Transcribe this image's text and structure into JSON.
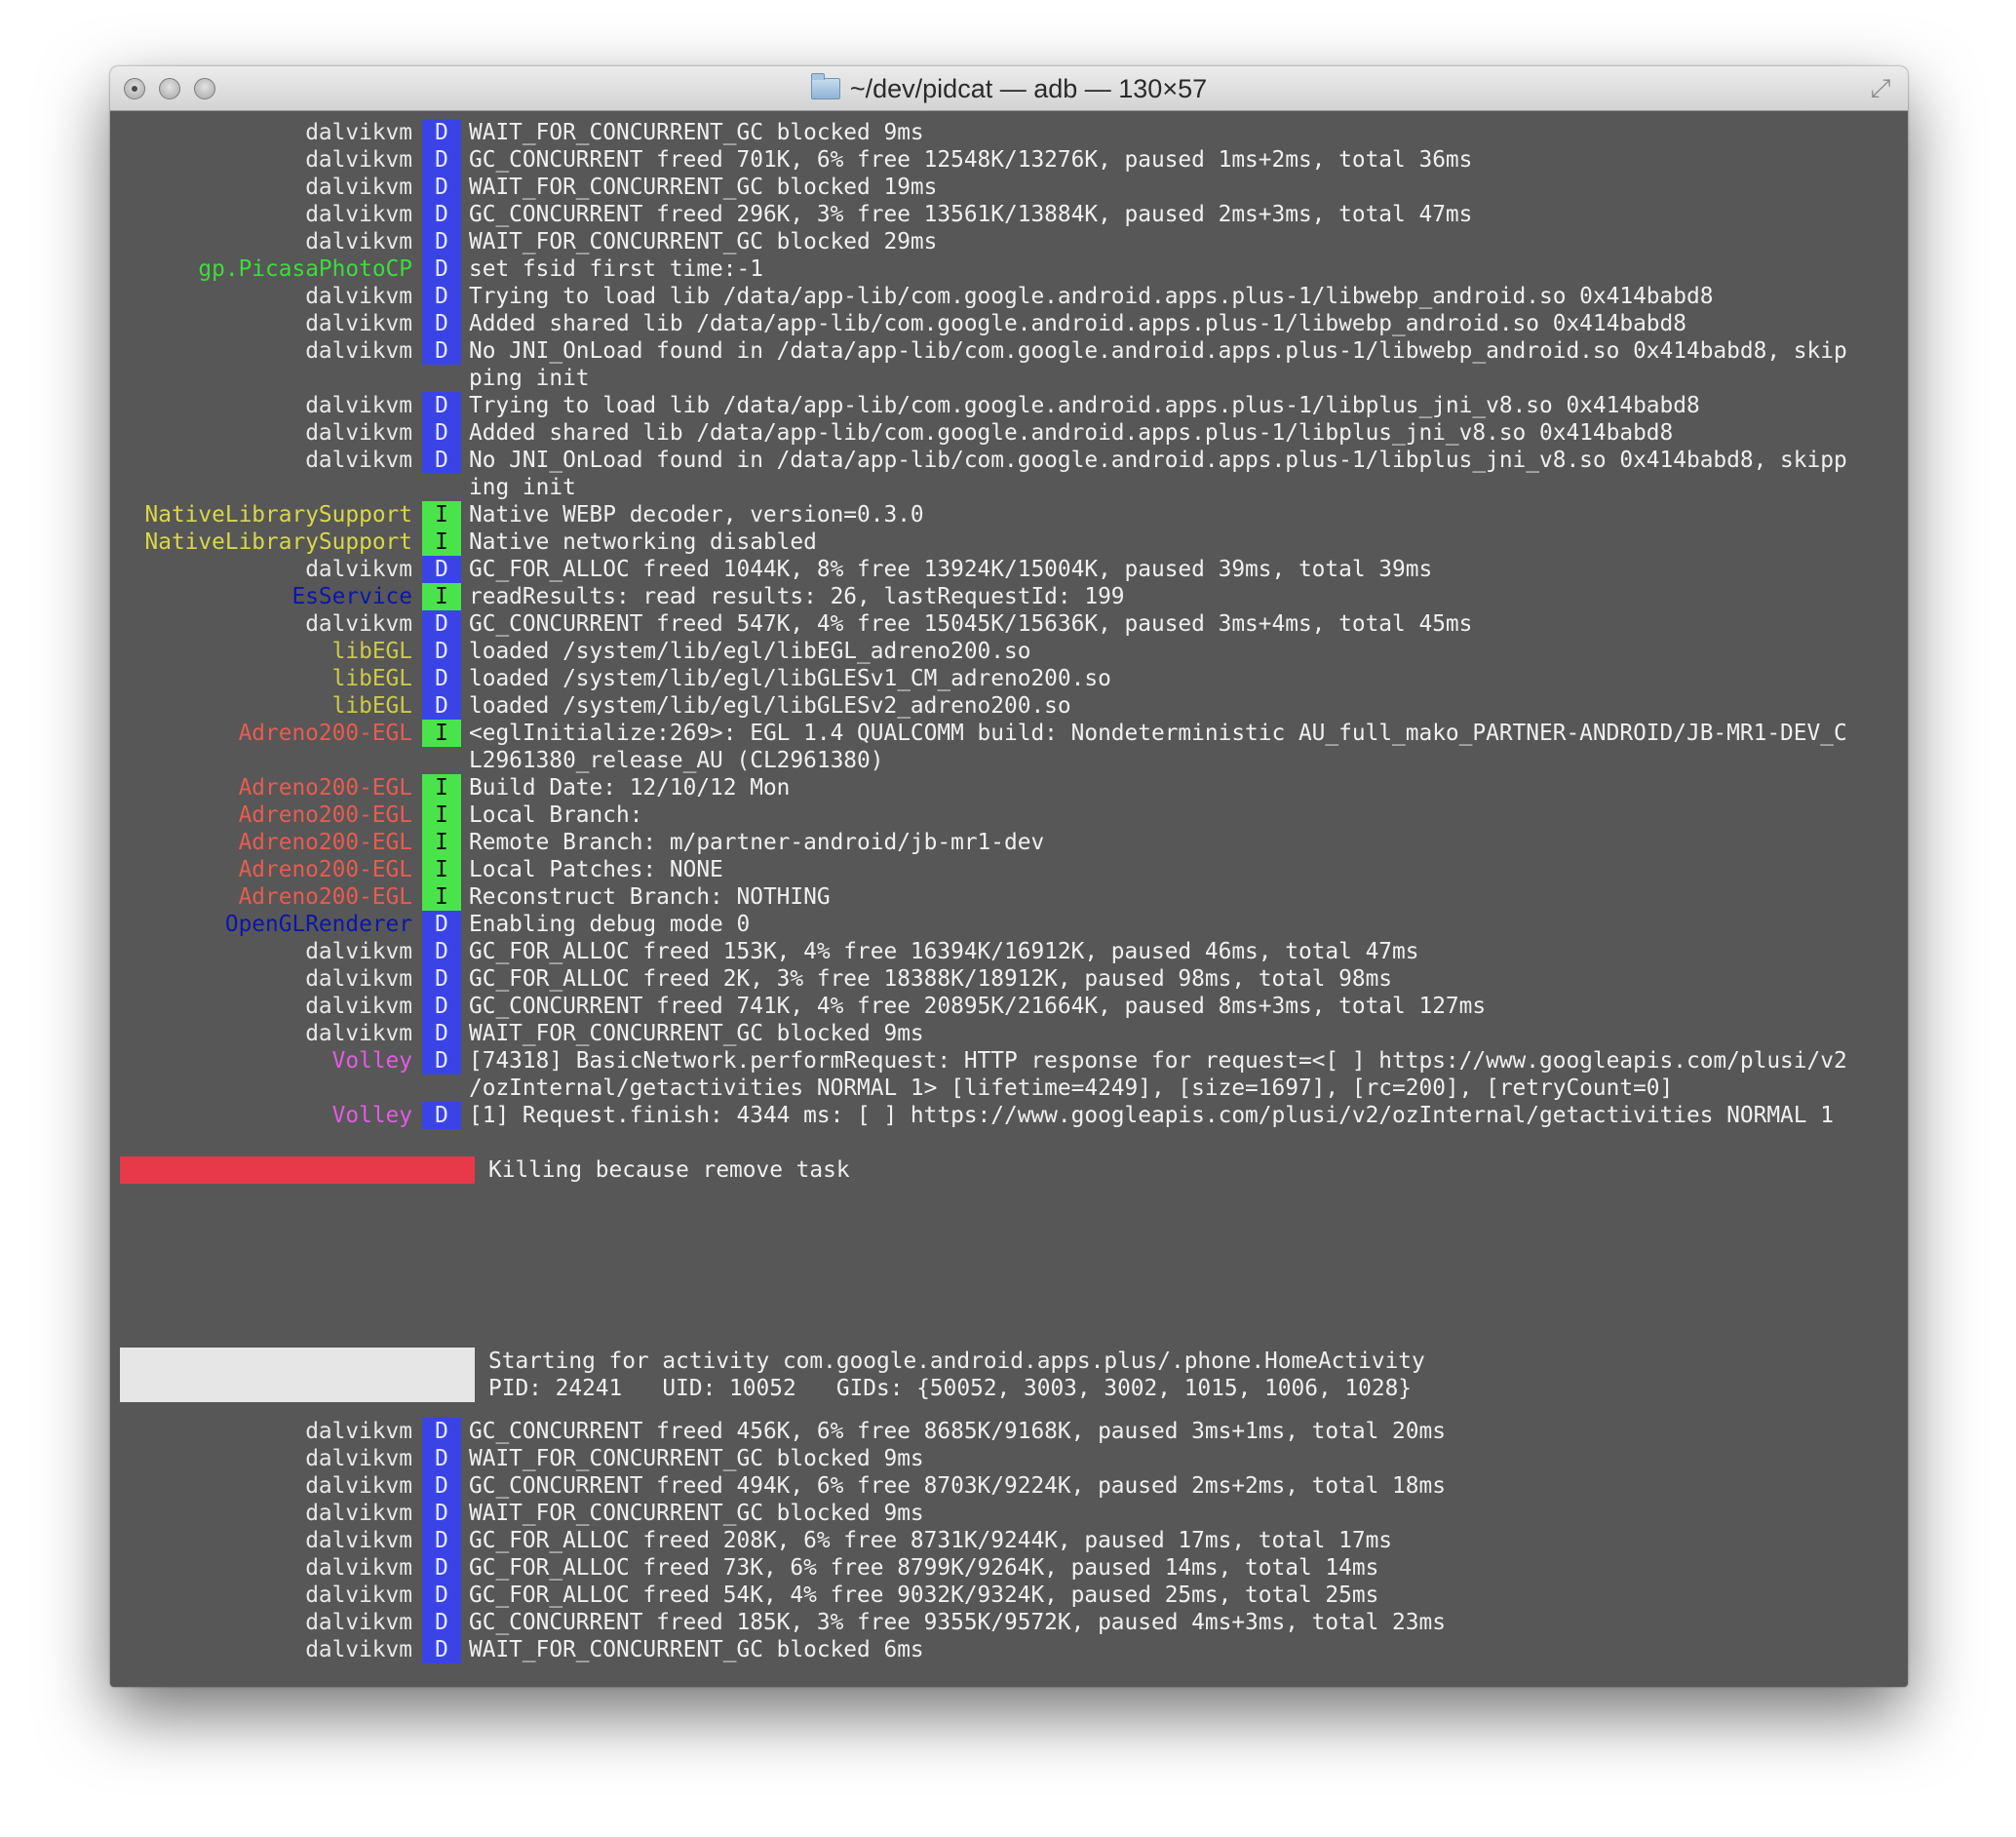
{
  "window": {
    "title": "~/dev/pidcat — adb — 130×57"
  },
  "colors": {
    "dalvikvm": "#e8e8e8",
    "gp.PicasaPhotoCP": "#3ddc3d",
    "NativeLibrarySupport": "#d8d84a",
    "EsService": "#0d16a8",
    "libEGL": "#cbcb46",
    "Adreno200-EGL": "#e85c50",
    "OpenGLRenderer": "#0d16a8",
    "Volley": "#e35ae3"
  },
  "lines_top": [
    {
      "tag": "dalvikvm",
      "lvl": "D",
      "msg": "WAIT_FOR_CONCURRENT_GC blocked 9ms"
    },
    {
      "tag": "dalvikvm",
      "lvl": "D",
      "msg": "GC_CONCURRENT freed 701K, 6% free 12548K/13276K, paused 1ms+2ms, total 36ms"
    },
    {
      "tag": "dalvikvm",
      "lvl": "D",
      "msg": "WAIT_FOR_CONCURRENT_GC blocked 19ms"
    },
    {
      "tag": "dalvikvm",
      "lvl": "D",
      "msg": "GC_CONCURRENT freed 296K, 3% free 13561K/13884K, paused 2ms+3ms, total 47ms"
    },
    {
      "tag": "dalvikvm",
      "lvl": "D",
      "msg": "WAIT_FOR_CONCURRENT_GC blocked 29ms"
    },
    {
      "tag": "gp.PicasaPhotoCP",
      "lvl": "D",
      "msg": "set fsid first time:-1"
    },
    {
      "tag": "dalvikvm",
      "lvl": "D",
      "msg": "Trying to load lib /data/app-lib/com.google.android.apps.plus-1/libwebp_android.so 0x414babd8"
    },
    {
      "tag": "dalvikvm",
      "lvl": "D",
      "msg": "Added shared lib /data/app-lib/com.google.android.apps.plus-1/libwebp_android.so 0x414babd8"
    },
    {
      "tag": "dalvikvm",
      "lvl": "D",
      "msg": "No JNI_OnLoad found in /data/app-lib/com.google.android.apps.plus-1/libwebp_android.so 0x414babd8, skip"
    },
    {
      "tag": "",
      "lvl": "",
      "msg": "ping init"
    },
    {
      "tag": "dalvikvm",
      "lvl": "D",
      "msg": "Trying to load lib /data/app-lib/com.google.android.apps.plus-1/libplus_jni_v8.so 0x414babd8"
    },
    {
      "tag": "dalvikvm",
      "lvl": "D",
      "msg": "Added shared lib /data/app-lib/com.google.android.apps.plus-1/libplus_jni_v8.so 0x414babd8"
    },
    {
      "tag": "dalvikvm",
      "lvl": "D",
      "msg": "No JNI_OnLoad found in /data/app-lib/com.google.android.apps.plus-1/libplus_jni_v8.so 0x414babd8, skipp"
    },
    {
      "tag": "",
      "lvl": "",
      "msg": "ing init"
    },
    {
      "tag": "NativeLibrarySupport",
      "lvl": "I",
      "msg": "Native WEBP decoder, version=0.3.0"
    },
    {
      "tag": "NativeLibrarySupport",
      "lvl": "I",
      "msg": "Native networking disabled"
    },
    {
      "tag": "dalvikvm",
      "lvl": "D",
      "msg": "GC_FOR_ALLOC freed 1044K, 8% free 13924K/15004K, paused 39ms, total 39ms"
    },
    {
      "tag": "EsService",
      "lvl": "I",
      "msg": "readResults: read results: 26, lastRequestId: 199"
    },
    {
      "tag": "dalvikvm",
      "lvl": "D",
      "msg": "GC_CONCURRENT freed 547K, 4% free 15045K/15636K, paused 3ms+4ms, total 45ms"
    },
    {
      "tag": "libEGL",
      "lvl": "D",
      "msg": "loaded /system/lib/egl/libEGL_adreno200.so"
    },
    {
      "tag": "libEGL",
      "lvl": "D",
      "msg": "loaded /system/lib/egl/libGLESv1_CM_adreno200.so"
    },
    {
      "tag": "libEGL",
      "lvl": "D",
      "msg": "loaded /system/lib/egl/libGLESv2_adreno200.so"
    },
    {
      "tag": "Adreno200-EGL",
      "lvl": "I",
      "msg": "<eglInitialize:269>: EGL 1.4 QUALCOMM build: Nondeterministic AU_full_mako_PARTNER-ANDROID/JB-MR1-DEV_C"
    },
    {
      "tag": "",
      "lvl": "",
      "msg": "L2961380_release_AU (CL2961380)"
    },
    {
      "tag": "Adreno200-EGL",
      "lvl": "I",
      "msg": "Build Date: 12/10/12 Mon"
    },
    {
      "tag": "Adreno200-EGL",
      "lvl": "I",
      "msg": "Local Branch:"
    },
    {
      "tag": "Adreno200-EGL",
      "lvl": "I",
      "msg": "Remote Branch: m/partner-android/jb-mr1-dev"
    },
    {
      "tag": "Adreno200-EGL",
      "lvl": "I",
      "msg": "Local Patches: NONE"
    },
    {
      "tag": "Adreno200-EGL",
      "lvl": "I",
      "msg": "Reconstruct Branch: NOTHING"
    },
    {
      "tag": "OpenGLRenderer",
      "lvl": "D",
      "msg": "Enabling debug mode 0"
    },
    {
      "tag": "dalvikvm",
      "lvl": "D",
      "msg": "GC_FOR_ALLOC freed 153K, 4% free 16394K/16912K, paused 46ms, total 47ms"
    },
    {
      "tag": "dalvikvm",
      "lvl": "D",
      "msg": "GC_FOR_ALLOC freed 2K, 3% free 18388K/18912K, paused 98ms, total 98ms"
    },
    {
      "tag": "dalvikvm",
      "lvl": "D",
      "msg": "GC_CONCURRENT freed 741K, 4% free 20895K/21664K, paused 8ms+3ms, total 127ms"
    },
    {
      "tag": "dalvikvm",
      "lvl": "D",
      "msg": "WAIT_FOR_CONCURRENT_GC blocked 9ms"
    },
    {
      "tag": "Volley",
      "lvl": "D",
      "msg": "[74318] BasicNetwork.performRequest: HTTP response for request=<[ ] https://www.googleapis.com/plusi/v2"
    },
    {
      "tag": "",
      "lvl": "",
      "msg": "/ozInternal/getactivities NORMAL 1> [lifetime=4249], [size=1697], [rc=200], [retryCount=0]"
    },
    {
      "tag": "Volley",
      "lvl": "D",
      "msg": "[1] Request.finish: 4344 ms: [ ] https://www.googleapis.com/plusi/v2/ozInternal/getactivities NORMAL 1"
    }
  ],
  "kill_message": "Killing because remove task",
  "start_message": {
    "line1": "Starting for activity com.google.android.apps.plus/.phone.HomeActivity",
    "line2": "PID: 24241   UID: 10052   GIDs: {50052, 3003, 3002, 1015, 1006, 1028}"
  },
  "lines_bottom": [
    {
      "tag": "dalvikvm",
      "lvl": "D",
      "msg": "GC_CONCURRENT freed 456K, 6% free 8685K/9168K, paused 3ms+1ms, total 20ms"
    },
    {
      "tag": "dalvikvm",
      "lvl": "D",
      "msg": "WAIT_FOR_CONCURRENT_GC blocked 9ms"
    },
    {
      "tag": "dalvikvm",
      "lvl": "D",
      "msg": "GC_CONCURRENT freed 494K, 6% free 8703K/9224K, paused 2ms+2ms, total 18ms"
    },
    {
      "tag": "dalvikvm",
      "lvl": "D",
      "msg": "WAIT_FOR_CONCURRENT_GC blocked 9ms"
    },
    {
      "tag": "dalvikvm",
      "lvl": "D",
      "msg": "GC_FOR_ALLOC freed 208K, 6% free 8731K/9244K, paused 17ms, total 17ms"
    },
    {
      "tag": "dalvikvm",
      "lvl": "D",
      "msg": "GC_FOR_ALLOC freed 73K, 6% free 8799K/9264K, paused 14ms, total 14ms"
    },
    {
      "tag": "dalvikvm",
      "lvl": "D",
      "msg": "GC_FOR_ALLOC freed 54K, 4% free 9032K/9324K, paused 25ms, total 25ms"
    },
    {
      "tag": "dalvikvm",
      "lvl": "D",
      "msg": "GC_CONCURRENT freed 185K, 3% free 9355K/9572K, paused 4ms+3ms, total 23ms"
    },
    {
      "tag": "dalvikvm",
      "lvl": "D",
      "msg": "WAIT_FOR_CONCURRENT_GC blocked 6ms"
    }
  ]
}
